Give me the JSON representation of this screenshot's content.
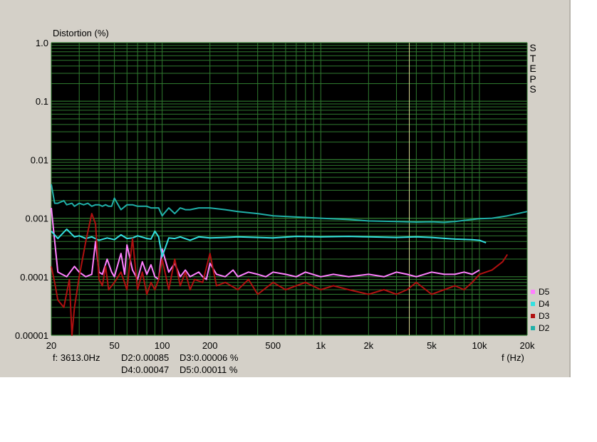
{
  "chart_data": {
    "type": "line",
    "ylabel": "Distortion (%)",
    "xlabel": "f (Hz)",
    "yscale": "log",
    "xscale": "log",
    "xlim": [
      20,
      20000
    ],
    "ylim": [
      1e-05,
      1.0
    ],
    "y_ticks": [
      "1.0",
      "0.1",
      "0.01",
      "0.001",
      "0.0001",
      "0.00001"
    ],
    "y_tick_values": [
      1.0,
      0.1,
      0.01,
      0.001,
      0.0001,
      1e-05
    ],
    "x_ticks": [
      "20",
      "50",
      "100",
      "200",
      "500",
      "1k",
      "2k",
      "5k",
      "10k",
      "20k"
    ],
    "x_tick_values": [
      20,
      50,
      100,
      200,
      500,
      1000,
      2000,
      5000,
      10000,
      20000
    ],
    "grid": true,
    "background": "#000000",
    "grid_color": "#2f7a2f",
    "legend_position": "right-bottom",
    "side_label": "STEPS",
    "cursor_x": 3613,
    "series": [
      {
        "name": "D5",
        "color": "#ff80ff",
        "x": [
          20,
          22,
          25,
          28,
          30,
          33,
          36,
          38,
          40,
          42,
          45,
          48,
          50,
          55,
          58,
          60,
          65,
          70,
          75,
          80,
          85,
          90,
          95,
          100,
          110,
          120,
          130,
          140,
          150,
          160,
          170,
          180,
          190,
          200,
          220,
          250,
          280,
          300,
          350,
          400,
          450,
          500,
          600,
          700,
          800,
          1000,
          1200,
          1500,
          2000,
          2500,
          3000,
          3500,
          4000,
          5000,
          6000,
          7000,
          8000,
          9000,
          10000
        ],
        "y": [
          0.0015,
          0.00012,
          0.0001,
          0.00015,
          0.00012,
          0.0001,
          0.00011,
          0.0004,
          0.00012,
          0.00011,
          0.0002,
          0.00012,
          0.0001,
          0.00025,
          0.00011,
          0.00035,
          0.00013,
          9e-05,
          0.00018,
          0.00011,
          0.00016,
          0.0001,
          9e-05,
          0.0003,
          0.00012,
          0.00017,
          0.0001,
          0.00013,
          0.0001,
          0.00011,
          0.00012,
          0.0001,
          9e-05,
          0.00017,
          0.00011,
          0.0001,
          0.00013,
          0.0001,
          0.00012,
          0.00011,
          0.0001,
          0.00012,
          0.00011,
          0.0001,
          0.00012,
          0.0001,
          0.00011,
          0.0001,
          0.00011,
          0.0001,
          0.00012,
          0.00011,
          0.0001,
          0.00012,
          0.00011,
          0.00011,
          0.00012,
          0.00011,
          0.00013
        ]
      },
      {
        "name": "D4",
        "color": "#33e0e0",
        "x": [
          20,
          22,
          25,
          28,
          30,
          33,
          36,
          40,
          45,
          50,
          55,
          60,
          65,
          70,
          80,
          85,
          90,
          95,
          100,
          110,
          120,
          130,
          150,
          170,
          200,
          250,
          300,
          400,
          500,
          700,
          1000,
          1500,
          2000,
          3000,
          4000,
          5000,
          7000,
          9000,
          10000,
          11000
        ],
        "y": [
          0.0006,
          0.00045,
          0.00065,
          0.00048,
          0.0005,
          0.00045,
          0.00048,
          0.00042,
          0.00046,
          0.00043,
          0.00052,
          0.00045,
          0.00046,
          0.0005,
          0.00045,
          0.00044,
          0.0006,
          0.00048,
          0.00022,
          0.00046,
          0.00045,
          0.00048,
          0.00042,
          0.00048,
          0.00046,
          0.00047,
          0.00048,
          0.00047,
          0.00046,
          0.00049,
          0.00048,
          0.00049,
          0.00048,
          0.00047,
          0.00048,
          0.00047,
          0.00044,
          0.00043,
          0.00042,
          0.00038
        ]
      },
      {
        "name": "D3",
        "color": "#b01010",
        "x": [
          20,
          21,
          22,
          24,
          26,
          27,
          28,
          30,
          33,
          36,
          38,
          40,
          42,
          44,
          46,
          50,
          55,
          60,
          65,
          70,
          75,
          80,
          85,
          90,
          95,
          100,
          110,
          120,
          130,
          140,
          150,
          160,
          180,
          200,
          220,
          250,
          300,
          350,
          400,
          500,
          600,
          700,
          800,
          1000,
          1200,
          1500,
          2000,
          2500,
          3000,
          3500,
          4000,
          5000,
          6000,
          7000,
          8000,
          9000,
          10000,
          12000,
          14000,
          15000
        ],
        "y": [
          0.00015,
          8e-05,
          4e-05,
          3e-05,
          9e-05,
          1e-05,
          3e-05,
          0.0001,
          0.0004,
          0.0012,
          0.0008,
          9e-05,
          7e-05,
          0.00015,
          6e-05,
          8e-05,
          0.00012,
          6e-05,
          0.00045,
          6e-05,
          0.00012,
          5e-05,
          8e-05,
          6e-05,
          9e-05,
          0.0002,
          6e-05,
          0.0002,
          7e-05,
          0.00012,
          6e-05,
          9e-05,
          8e-05,
          0.00025,
          7e-05,
          8e-05,
          6e-05,
          9e-05,
          5e-05,
          8e-05,
          6e-05,
          7e-05,
          8e-05,
          6e-05,
          7e-05,
          6e-05,
          5e-05,
          6e-05,
          5e-05,
          6e-05,
          8e-05,
          5e-05,
          6e-05,
          7e-05,
          6e-05,
          8e-05,
          0.00011,
          0.00013,
          0.00018,
          0.00024
        ]
      },
      {
        "name": "D2",
        "color": "#20b0a8",
        "x": [
          20,
          21,
          22,
          24,
          25,
          27,
          28,
          30,
          32,
          34,
          36,
          38,
          40,
          42,
          44,
          46,
          48,
          50,
          55,
          60,
          65,
          70,
          75,
          80,
          85,
          90,
          95,
          100,
          110,
          120,
          130,
          140,
          150,
          170,
          200,
          250,
          300,
          400,
          500,
          700,
          1000,
          1500,
          2000,
          3000,
          4000,
          5000,
          6000,
          7000,
          8000,
          9000,
          10000,
          12000,
          15000,
          20000
        ],
        "y": [
          0.0038,
          0.0018,
          0.0018,
          0.002,
          0.0017,
          0.0018,
          0.0016,
          0.0018,
          0.0017,
          0.0018,
          0.0016,
          0.0017,
          0.0017,
          0.0016,
          0.0017,
          0.0016,
          0.0016,
          0.0022,
          0.0014,
          0.0017,
          0.0017,
          0.0016,
          0.0016,
          0.0016,
          0.0015,
          0.0015,
          0.0015,
          0.0011,
          0.0015,
          0.0012,
          0.0015,
          0.0014,
          0.0014,
          0.0015,
          0.0015,
          0.0014,
          0.0013,
          0.0012,
          0.0011,
          0.00105,
          0.001,
          0.00095,
          0.0009,
          0.00088,
          0.00086,
          0.00087,
          0.00085,
          0.00088,
          0.00092,
          0.00095,
          0.00098,
          0.001,
          0.0011,
          0.0013
        ]
      }
    ]
  },
  "status": {
    "freq": "f: 3613.0Hz",
    "d2": "D2:0.00085",
    "d3": "D3:0.00006 %",
    "d4": "D4:0.00047",
    "d5": "D5:0.00011  %"
  }
}
